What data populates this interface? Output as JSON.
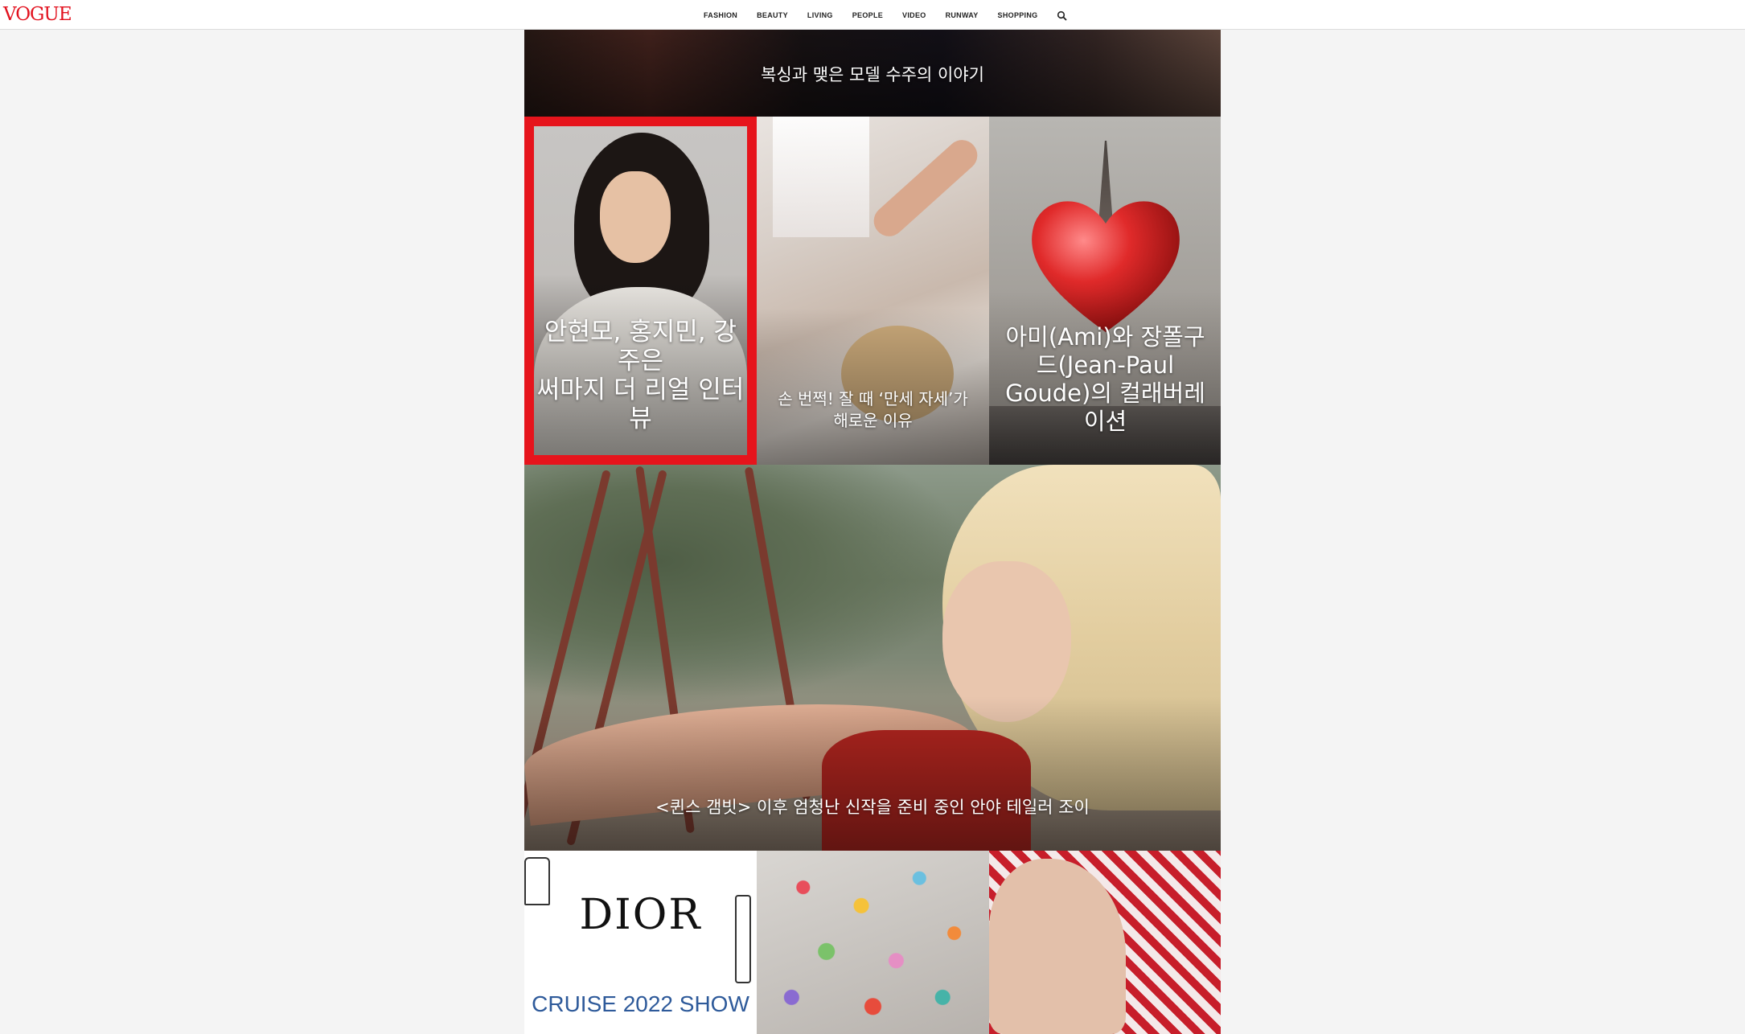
{
  "header": {
    "logo": "VOGUE",
    "nav": [
      "FASHION",
      "BEAUTY",
      "LIVING",
      "PEOPLE",
      "VIDEO",
      "RUNWAY",
      "SHOPPING"
    ],
    "search_icon": "search-icon"
  },
  "tiles": {
    "top_banner": "복싱과 맺은 모델 수주의 이야기",
    "row1": [
      {
        "caption": "안현모, 홍지민, 강주은\n써마지 더 리얼 인터뷰",
        "highlighted": true,
        "highlight_color": "#e6141c"
      },
      {
        "caption": "손 번쩍! 잘 때 ‘만세 자세’가 해로운 이유"
      },
      {
        "caption": "아미(Ami)와 장폴구드(Jean-Paul Goude)의 컬래버레이션"
      }
    ],
    "feature": "<퀸스 갬빗> 이후 엄청난 신작을 준비 중인 안야 테일러 조이",
    "row2": [
      {
        "brand": "DIOR",
        "subtitle": "CRUISE 2022 SHOW"
      },
      {
        "image": "colorful-pills"
      },
      {
        "image": "painted-nails"
      }
    ]
  },
  "colors": {
    "logo": "#e2111e",
    "highlight": "#e6141c",
    "background": "#f4f4f4"
  }
}
